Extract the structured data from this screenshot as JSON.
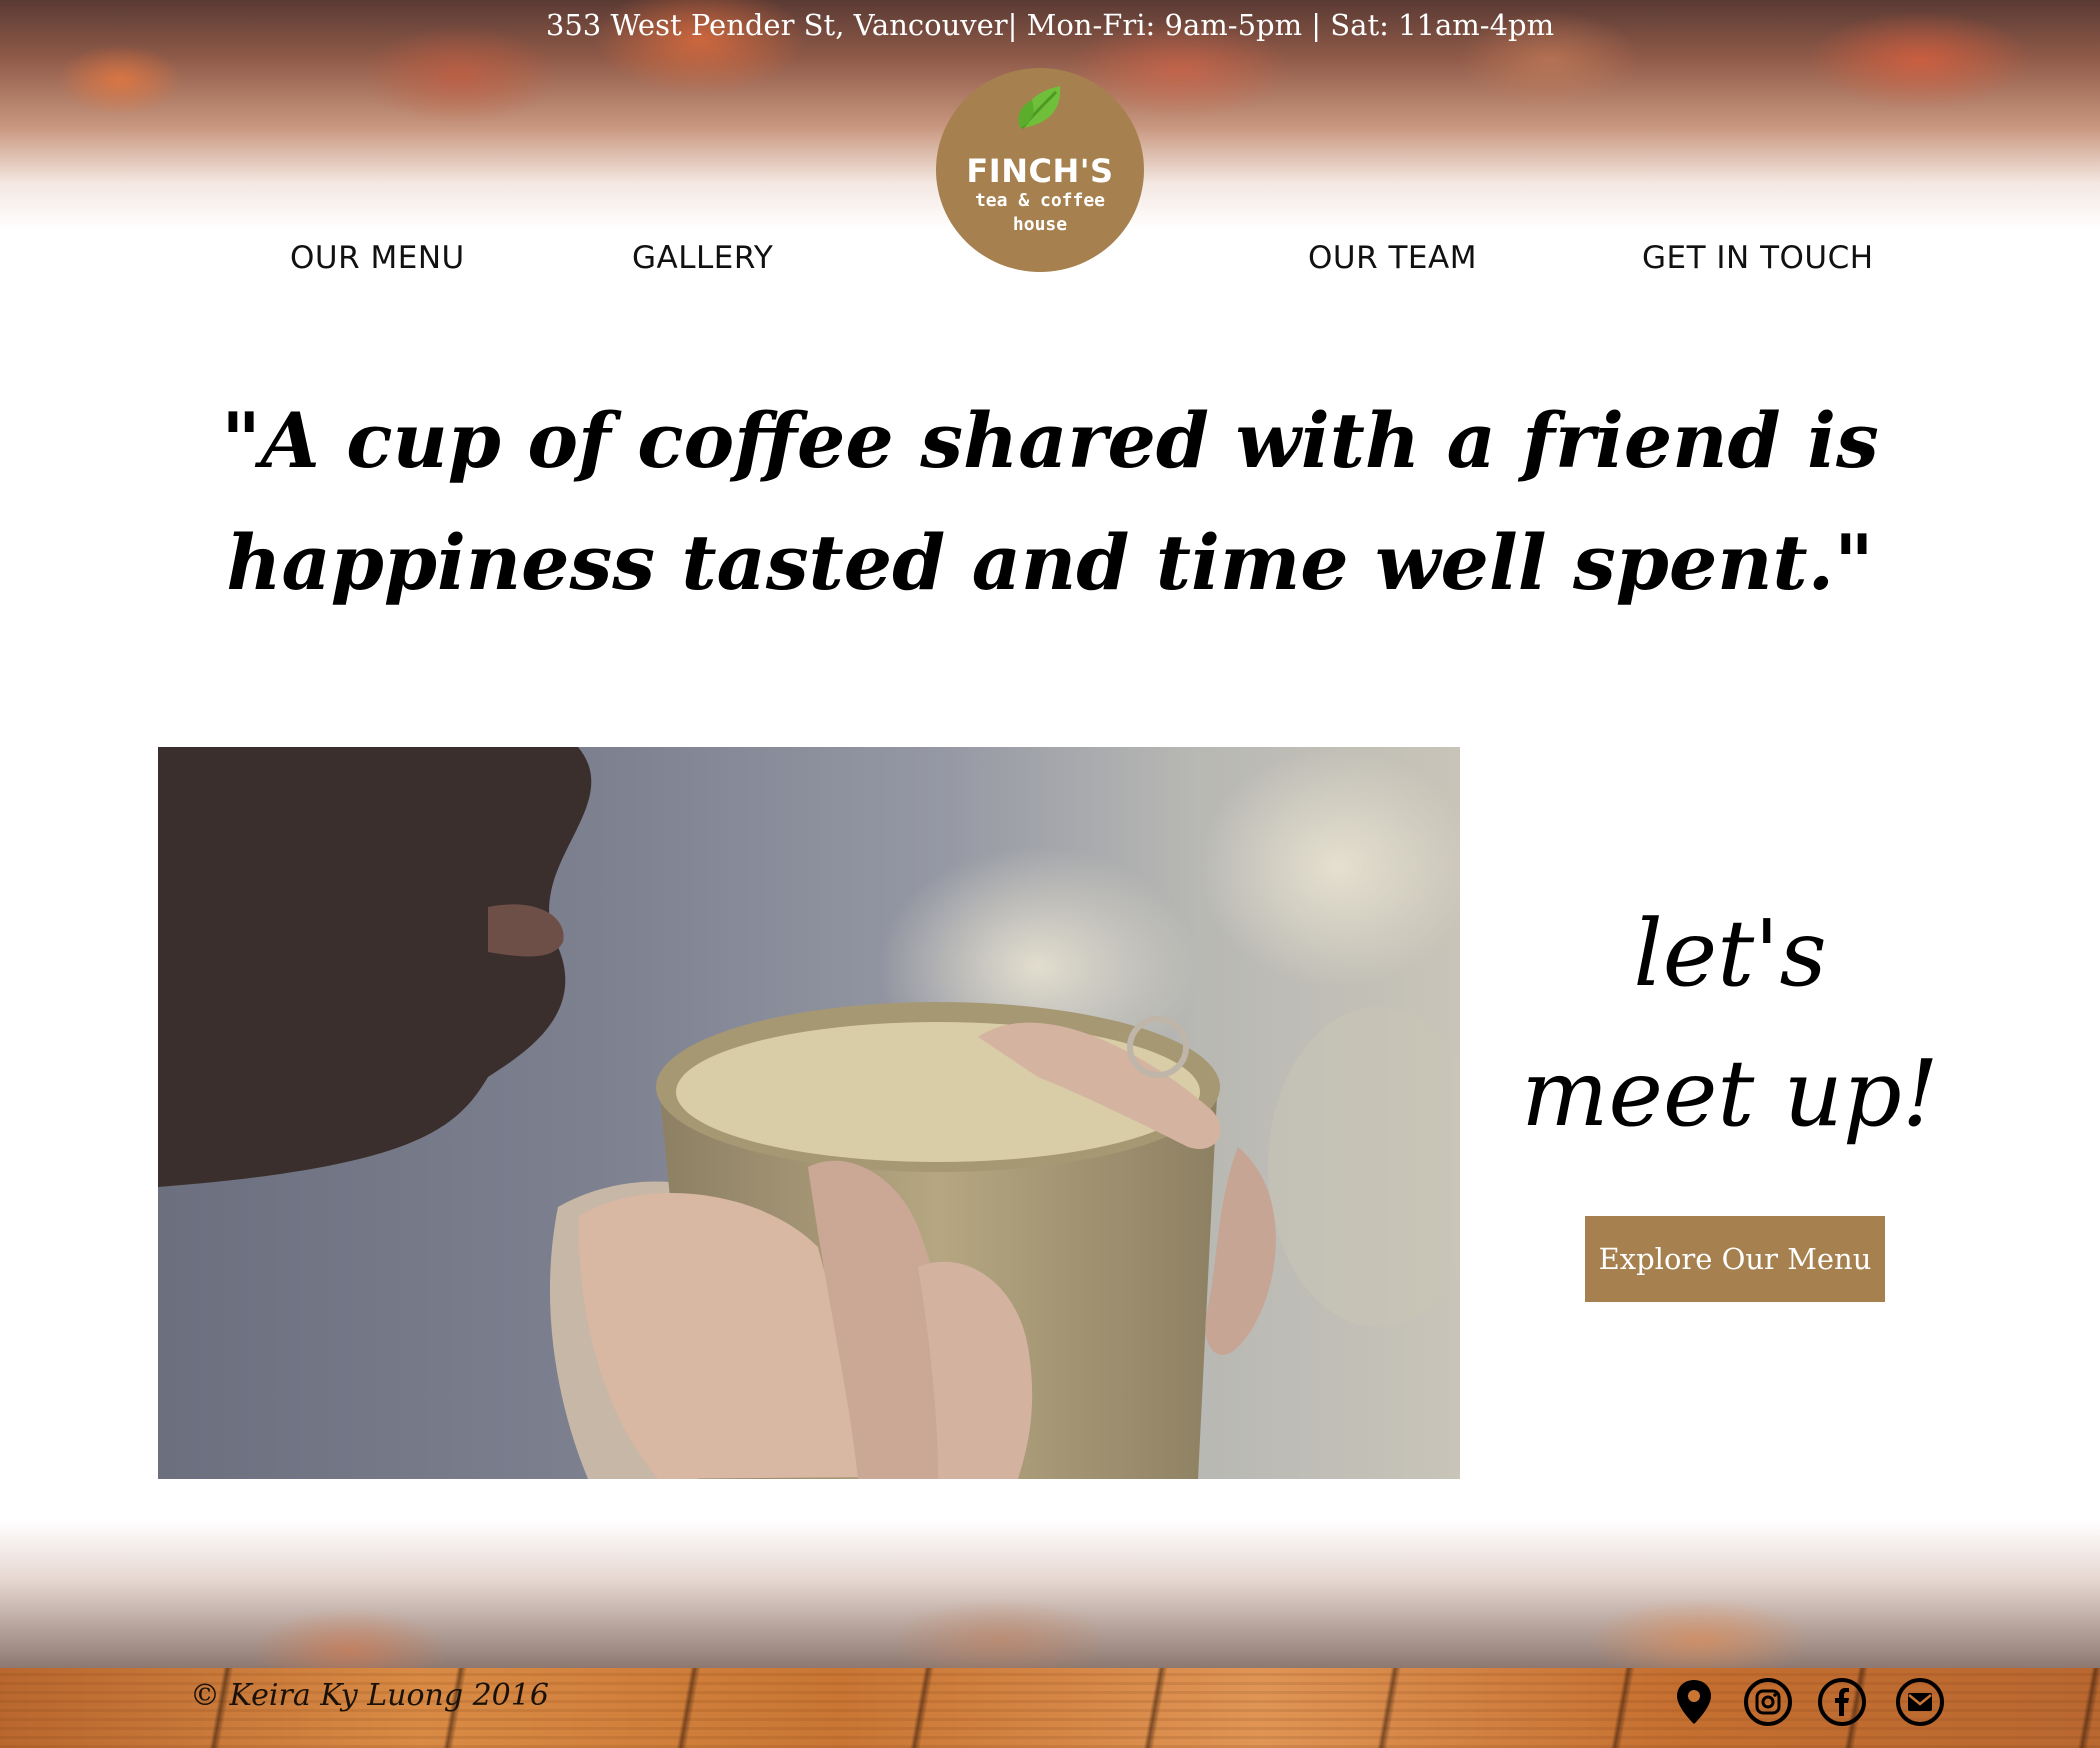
{
  "topbar": {
    "info": "353 West Pender St, Vancouver| Mon-Fri: 9am-5pm | Sat: 11am-4pm"
  },
  "logo": {
    "name": "FINCH'S",
    "tagline_1": "tea & coffee",
    "tagline_2": "house",
    "leaf_icon": "leaf-icon",
    "colors": {
      "badge": "#a6804f",
      "leaf": "#6fbf3a"
    }
  },
  "nav": {
    "items": [
      {
        "label": "OUR MENU"
      },
      {
        "label": "GALLERY"
      },
      {
        "label": "OUR TEAM"
      },
      {
        "label": "GET IN TOUCH"
      }
    ]
  },
  "quote": {
    "text": "\"A cup of coffee shared with a friend is happiness tasted and time well spent.\""
  },
  "meetup": {
    "line1": "let's",
    "line2": "meet up!",
    "button_label": "Explore Our Menu",
    "button_color": "#a6804f"
  },
  "footer": {
    "copyright": "© Keira Ky Luong 2016",
    "icons": [
      "location-pin-icon",
      "instagram-icon",
      "facebook-icon",
      "mail-icon"
    ]
  }
}
